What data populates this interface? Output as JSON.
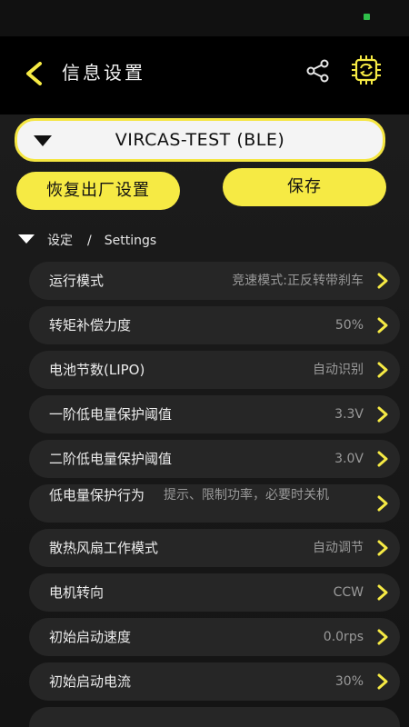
{
  "header": {
    "title": "信息设置"
  },
  "device": {
    "name": "VIRCAS-TEST (BLE)"
  },
  "actions": {
    "reset_label": "恢复出厂设置",
    "save_label": "保存"
  },
  "section": {
    "title_cn": "设定",
    "separator": "/",
    "title_en": "Settings"
  },
  "settings": [
    {
      "label": "运行模式",
      "value": "竞速模式:正反转带刹车"
    },
    {
      "label": "转矩补偿力度",
      "value": "50%"
    },
    {
      "label": "电池节数(LIPO)",
      "value": "自动识别"
    },
    {
      "label": "一阶低电量保护阈值",
      "value": "3.3V"
    },
    {
      "label": "二阶低电量保护阈值",
      "value": "3.0V"
    },
    {
      "label": "低电量保护行为",
      "value": "提示、限制功率，必要时关机"
    },
    {
      "label": "散热风扇工作模式",
      "value": "自动调节"
    },
    {
      "label": "电机转向",
      "value": "CCW"
    },
    {
      "label": "初始启动速度",
      "value": "0.0rps"
    },
    {
      "label": "初始启动电流",
      "value": "30%"
    }
  ],
  "colors": {
    "accent": "#f6ea44",
    "background": "#111111",
    "row": "#262626"
  }
}
